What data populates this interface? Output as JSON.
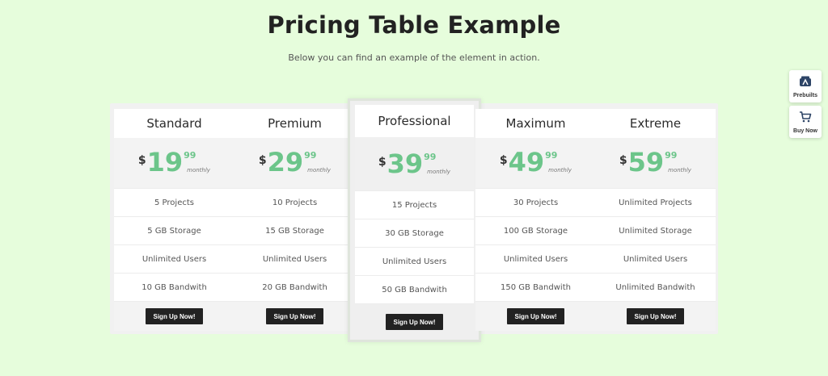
{
  "page": {
    "title": "Pricing Table Example",
    "subtitle": "Below you can find an example of the element in action."
  },
  "plans": [
    {
      "name": "Standard",
      "currency": "$",
      "amount": "19",
      "cents": "99",
      "period": "monthly",
      "features": [
        "5 Projects",
        "5 GB Storage",
        "Unlimited Users",
        "10 GB Bandwith"
      ],
      "cta": "Sign Up Now!"
    },
    {
      "name": "Premium",
      "currency": "$",
      "amount": "29",
      "cents": "99",
      "period": "monthly",
      "features": [
        "10 Projects",
        "15 GB Storage",
        "Unlimited Users",
        "20 GB Bandwith"
      ],
      "cta": "Sign Up Now!"
    },
    {
      "name": "Professional",
      "currency": "$",
      "amount": "39",
      "cents": "99",
      "period": "monthly",
      "features": [
        "15 Projects",
        "30 GB Storage",
        "Unlimited Users",
        "50 GB Bandwith"
      ],
      "cta": "Sign Up Now!"
    },
    {
      "name": "Maximum",
      "currency": "$",
      "amount": "49",
      "cents": "99",
      "period": "monthly",
      "features": [
        "30 Projects",
        "100 GB Storage",
        "Unlimited Users",
        "150 GB Bandwith"
      ],
      "cta": "Sign Up Now!"
    },
    {
      "name": "Extreme",
      "currency": "$",
      "amount": "59",
      "cents": "99",
      "period": "monthly",
      "features": [
        "Unlimited Projects",
        "Unlimited Storage",
        "Unlimited Users",
        "Unlimited Bandwith"
      ],
      "cta": "Sign Up Now!"
    }
  ],
  "side_widgets": {
    "prebuilts_label": "Prebuilts",
    "buy_now_label": "Buy Now"
  },
  "colors": {
    "background": "#e6fddc",
    "price_accent": "#6cc58a",
    "button": "#222222"
  }
}
